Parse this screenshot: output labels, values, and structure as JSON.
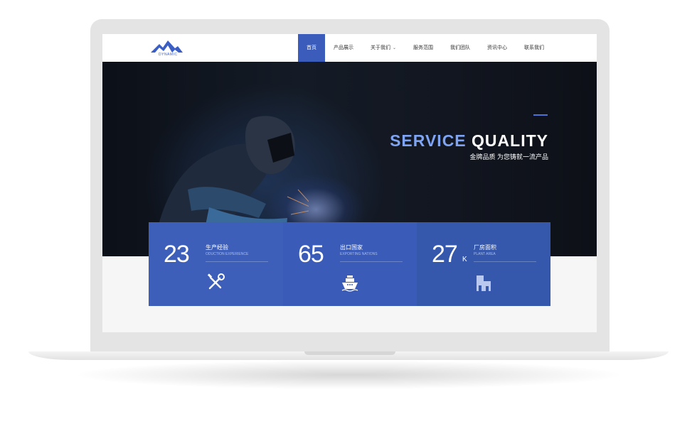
{
  "brand": {
    "logo_text": "DYNAMIC",
    "accent": "#3b5cbb"
  },
  "nav": {
    "items": [
      {
        "label": "首页",
        "active": true
      },
      {
        "label": "产品展示"
      },
      {
        "label": "关于我们",
        "has_dropdown": true
      },
      {
        "label": "服务范围"
      },
      {
        "label": "我们团队"
      },
      {
        "label": "资讯中心"
      },
      {
        "label": "联系我们"
      }
    ]
  },
  "hero": {
    "title_part1": "SERVICE",
    "title_part2": "QUALITY",
    "subtitle": "金牌品质 为您铸就一流产品"
  },
  "stats": [
    {
      "value": "23",
      "suffix": "",
      "label_zh": "生产经验",
      "label_en": "ODUCTION EXPERIENCE",
      "icon": "tools-icon"
    },
    {
      "value": "65",
      "suffix": "",
      "label_zh": "出口国家",
      "label_en": "EXPORTING NATIONS",
      "icon": "ship-icon"
    },
    {
      "value": "27",
      "suffix": "K",
      "label_zh": "厂房面积",
      "label_en": "PLANT AREA",
      "icon": "building-icon"
    }
  ]
}
